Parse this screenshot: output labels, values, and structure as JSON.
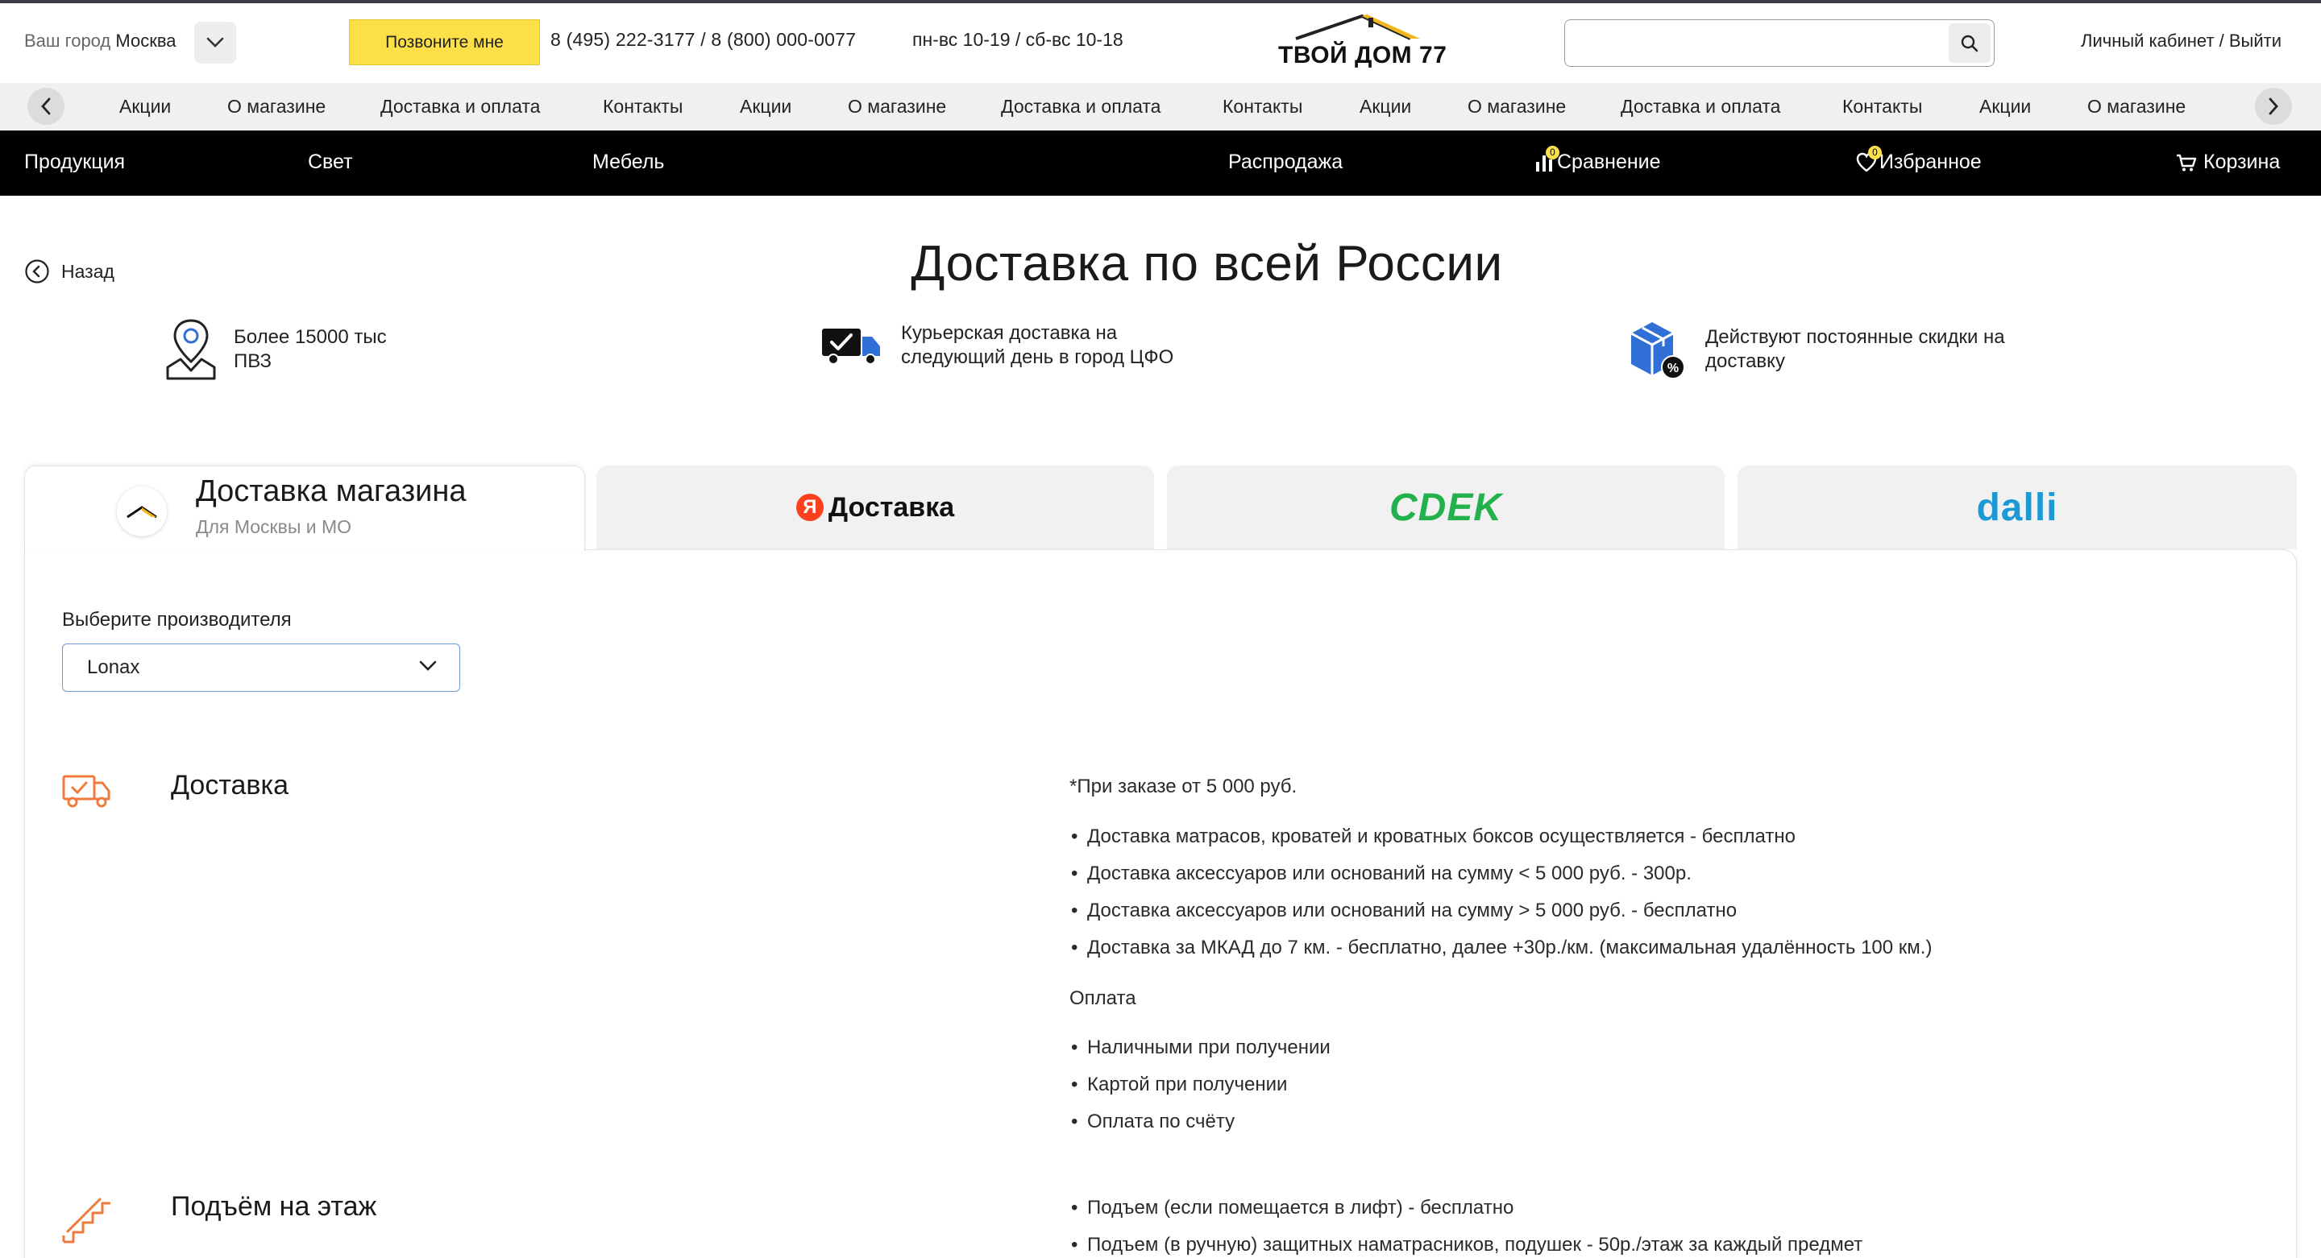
{
  "header": {
    "city_prefix": "Ваш город",
    "city": "Москва",
    "call_button": "Позвоните мне",
    "phones": "8 (495) 222-3177 / 8 (800) 000-0077",
    "hours": "пн-вс 10-19 / сб-вс 10-18",
    "logo_text": "ТВОЙ ДОМ 77",
    "search_placeholder": "",
    "account": "Личный кабинет / Выйти"
  },
  "subnav": {
    "items": [
      "Акции",
      "О магазине",
      "Доставка и оплата",
      "Контакты",
      "Акции",
      "О магазине",
      "Доставка и оплата",
      "Контакты",
      "Акции",
      "О магазине",
      "Доставка и оплата",
      "Контакты",
      "Акции",
      "О магазине"
    ]
  },
  "mainnav": {
    "products": "Продукция",
    "light": "Свет",
    "furniture": "Мебель",
    "sale": "Распродажа",
    "compare": "Сравнение",
    "compare_count": "0",
    "favorites": "Избранное",
    "favorites_count": "0",
    "cart": "Корзина"
  },
  "page": {
    "back": "Назад",
    "title": "Доставка по всей России"
  },
  "features": [
    {
      "icon": "map-pin-icon",
      "line1": "Более 15000 тыс",
      "line2": "ПВЗ"
    },
    {
      "icon": "delivery-truck-icon",
      "line1": "Курьерская доставка на",
      "line2": "следующий день в город ЦФО"
    },
    {
      "icon": "discount-box-icon",
      "line1": "Действуют постоянные скидки на",
      "line2": "доставку"
    }
  ],
  "tabs": {
    "store_title": "Доставка магазина",
    "store_subtitle": "Для Москвы и МО",
    "yandex_letter": "Я",
    "yandex_label": "Доставка",
    "cdek_label": "CDEK",
    "dalli_label": "dalli"
  },
  "colors": {
    "accent_yellow": "#fde047",
    "cdek_green": "#22b14c",
    "dalli_blue": "#1c9ad6",
    "yandex_red": "#fc3f1d",
    "icon_orange": "#f07a3c"
  },
  "maker": {
    "label": "Выберите производителя",
    "selected": "Lonax"
  },
  "delivery": {
    "title": "Доставка",
    "note": "*При заказе от 5 000 руб.",
    "items": [
      "Доставка матрасов, кроватей и кроватных боксов осуществляется - бесплатно",
      "Доставка аксессуаров или оснований на сумму < 5 000 руб. - 300р.",
      "Доставка аксессуаров или оснований на сумму > 5 000 руб. - бесплатно",
      "Доставка за МКАД до 7 км. - бесплатно, далее +30р./км. (максимальная удалённость 100 км.)"
    ],
    "payment_title": "Оплата",
    "payment_items": [
      "Наличными при получении",
      "Картой при получении",
      "Оплата по счёту"
    ]
  },
  "lift": {
    "title": "Подъём на этаж",
    "items": [
      "Подъем (если помещается в лифт) - бесплатно",
      "Подъем (в ручную) защитных наматрасников, подушек - 50р./этаж за каждый предмет"
    ]
  }
}
